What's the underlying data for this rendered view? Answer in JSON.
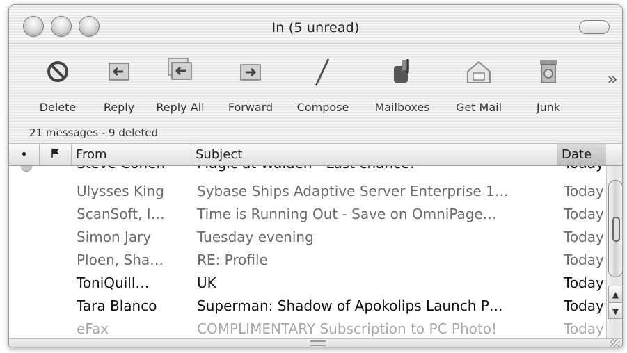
{
  "window": {
    "title": "In (5 unread)"
  },
  "toolbar": {
    "buttons": [
      {
        "label": "Delete",
        "icon": "delete-icon"
      },
      {
        "label": "Reply",
        "icon": "reply-icon"
      },
      {
        "label": "Reply All",
        "icon": "reply-all-icon"
      },
      {
        "label": "Forward",
        "icon": "forward-icon"
      },
      {
        "label": "Compose",
        "icon": "compose-icon"
      },
      {
        "label": "Mailboxes",
        "icon": "mailboxes-icon"
      },
      {
        "label": "Get Mail",
        "icon": "get-mail-icon"
      },
      {
        "label": "Junk",
        "icon": "junk-icon"
      }
    ],
    "overflow": "»"
  },
  "status": {
    "text": "21 messages - 9 deleted"
  },
  "columns": {
    "status_symbol": "•",
    "flag_icon": "flag-icon",
    "from": "From",
    "subject": "Subject",
    "date": "Date"
  },
  "messages": [
    {
      "from": "Steve Cohen",
      "subject": "Magic at Walden - Last chance!",
      "date": "Today",
      "state": "partial"
    },
    {
      "from": "Ulysses King",
      "subject": "Sybase Ships Adaptive Server Enterprise 1…",
      "date": "Today",
      "state": "read"
    },
    {
      "from": "ScanSoft, I…",
      "subject": "Time is Running Out - Save on OmniPage…",
      "date": "Today",
      "state": "read"
    },
    {
      "from": "Simon Jary",
      "subject": "Tuesday evening",
      "date": "Today",
      "state": "read"
    },
    {
      "from": "Ploen, Sha…",
      "subject": "RE: Profile",
      "date": "Today",
      "state": "read"
    },
    {
      "from": "ToniQuill…",
      "subject": "UK",
      "date": "Today",
      "state": "unread"
    },
    {
      "from": "Tara Blanco",
      "subject": "Superman: Shadow of Apokolips Launch P…",
      "date": "Today",
      "state": "unread"
    },
    {
      "from": "eFax",
      "subject": "COMPLIMENTARY Subscription to PC Photo!",
      "date": "Today",
      "state": "faded"
    }
  ],
  "scrollbar": {
    "up_arrow": "▲",
    "down_arrow": "▼"
  }
}
